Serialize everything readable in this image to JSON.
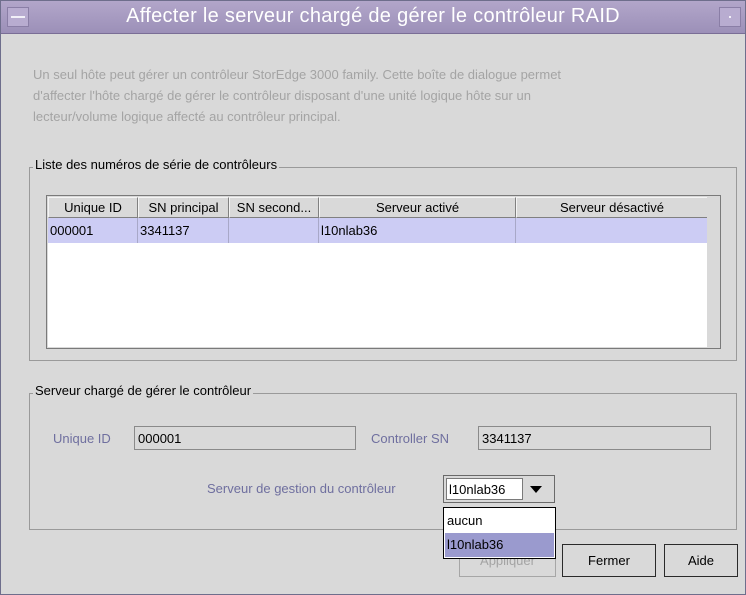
{
  "window": {
    "title": "Affecter le serveur chargé de gérer le contrôleur RAID"
  },
  "description": {
    "line1": "Un seul hôte peut gérer un contrôleur StorEdge 3000 family. Cette boîte de dialogue permet",
    "line2": "d'affecter l'hôte chargé de gérer le contrôleur disposant d'une unité logique hôte sur un",
    "line3": "lecteur/volume logique affecté au contrôleur principal."
  },
  "controller_list": {
    "group_label": "Liste des numéros de série de contrôleurs",
    "columns": [
      "Unique ID",
      "SN principal",
      "SN second...",
      "Serveur activé",
      "Serveur désactivé"
    ],
    "rows": [
      [
        "000001",
        "3341137",
        "",
        "l10nlab36",
        ""
      ]
    ]
  },
  "manager_section": {
    "group_label": "Serveur chargé de gérer le contrôleur",
    "unique_id_label": "Unique ID",
    "unique_id_value": "000001",
    "controller_sn_label": "Controller SN",
    "controller_sn_value": "3341137",
    "server_label": "Serveur de gestion du contrôleur",
    "server_selected": "l10nlab36",
    "server_options": [
      "aucun",
      "l10nlab36"
    ]
  },
  "buttons": {
    "apply": "Appliquer",
    "close": "Fermer",
    "help": "Aide"
  }
}
